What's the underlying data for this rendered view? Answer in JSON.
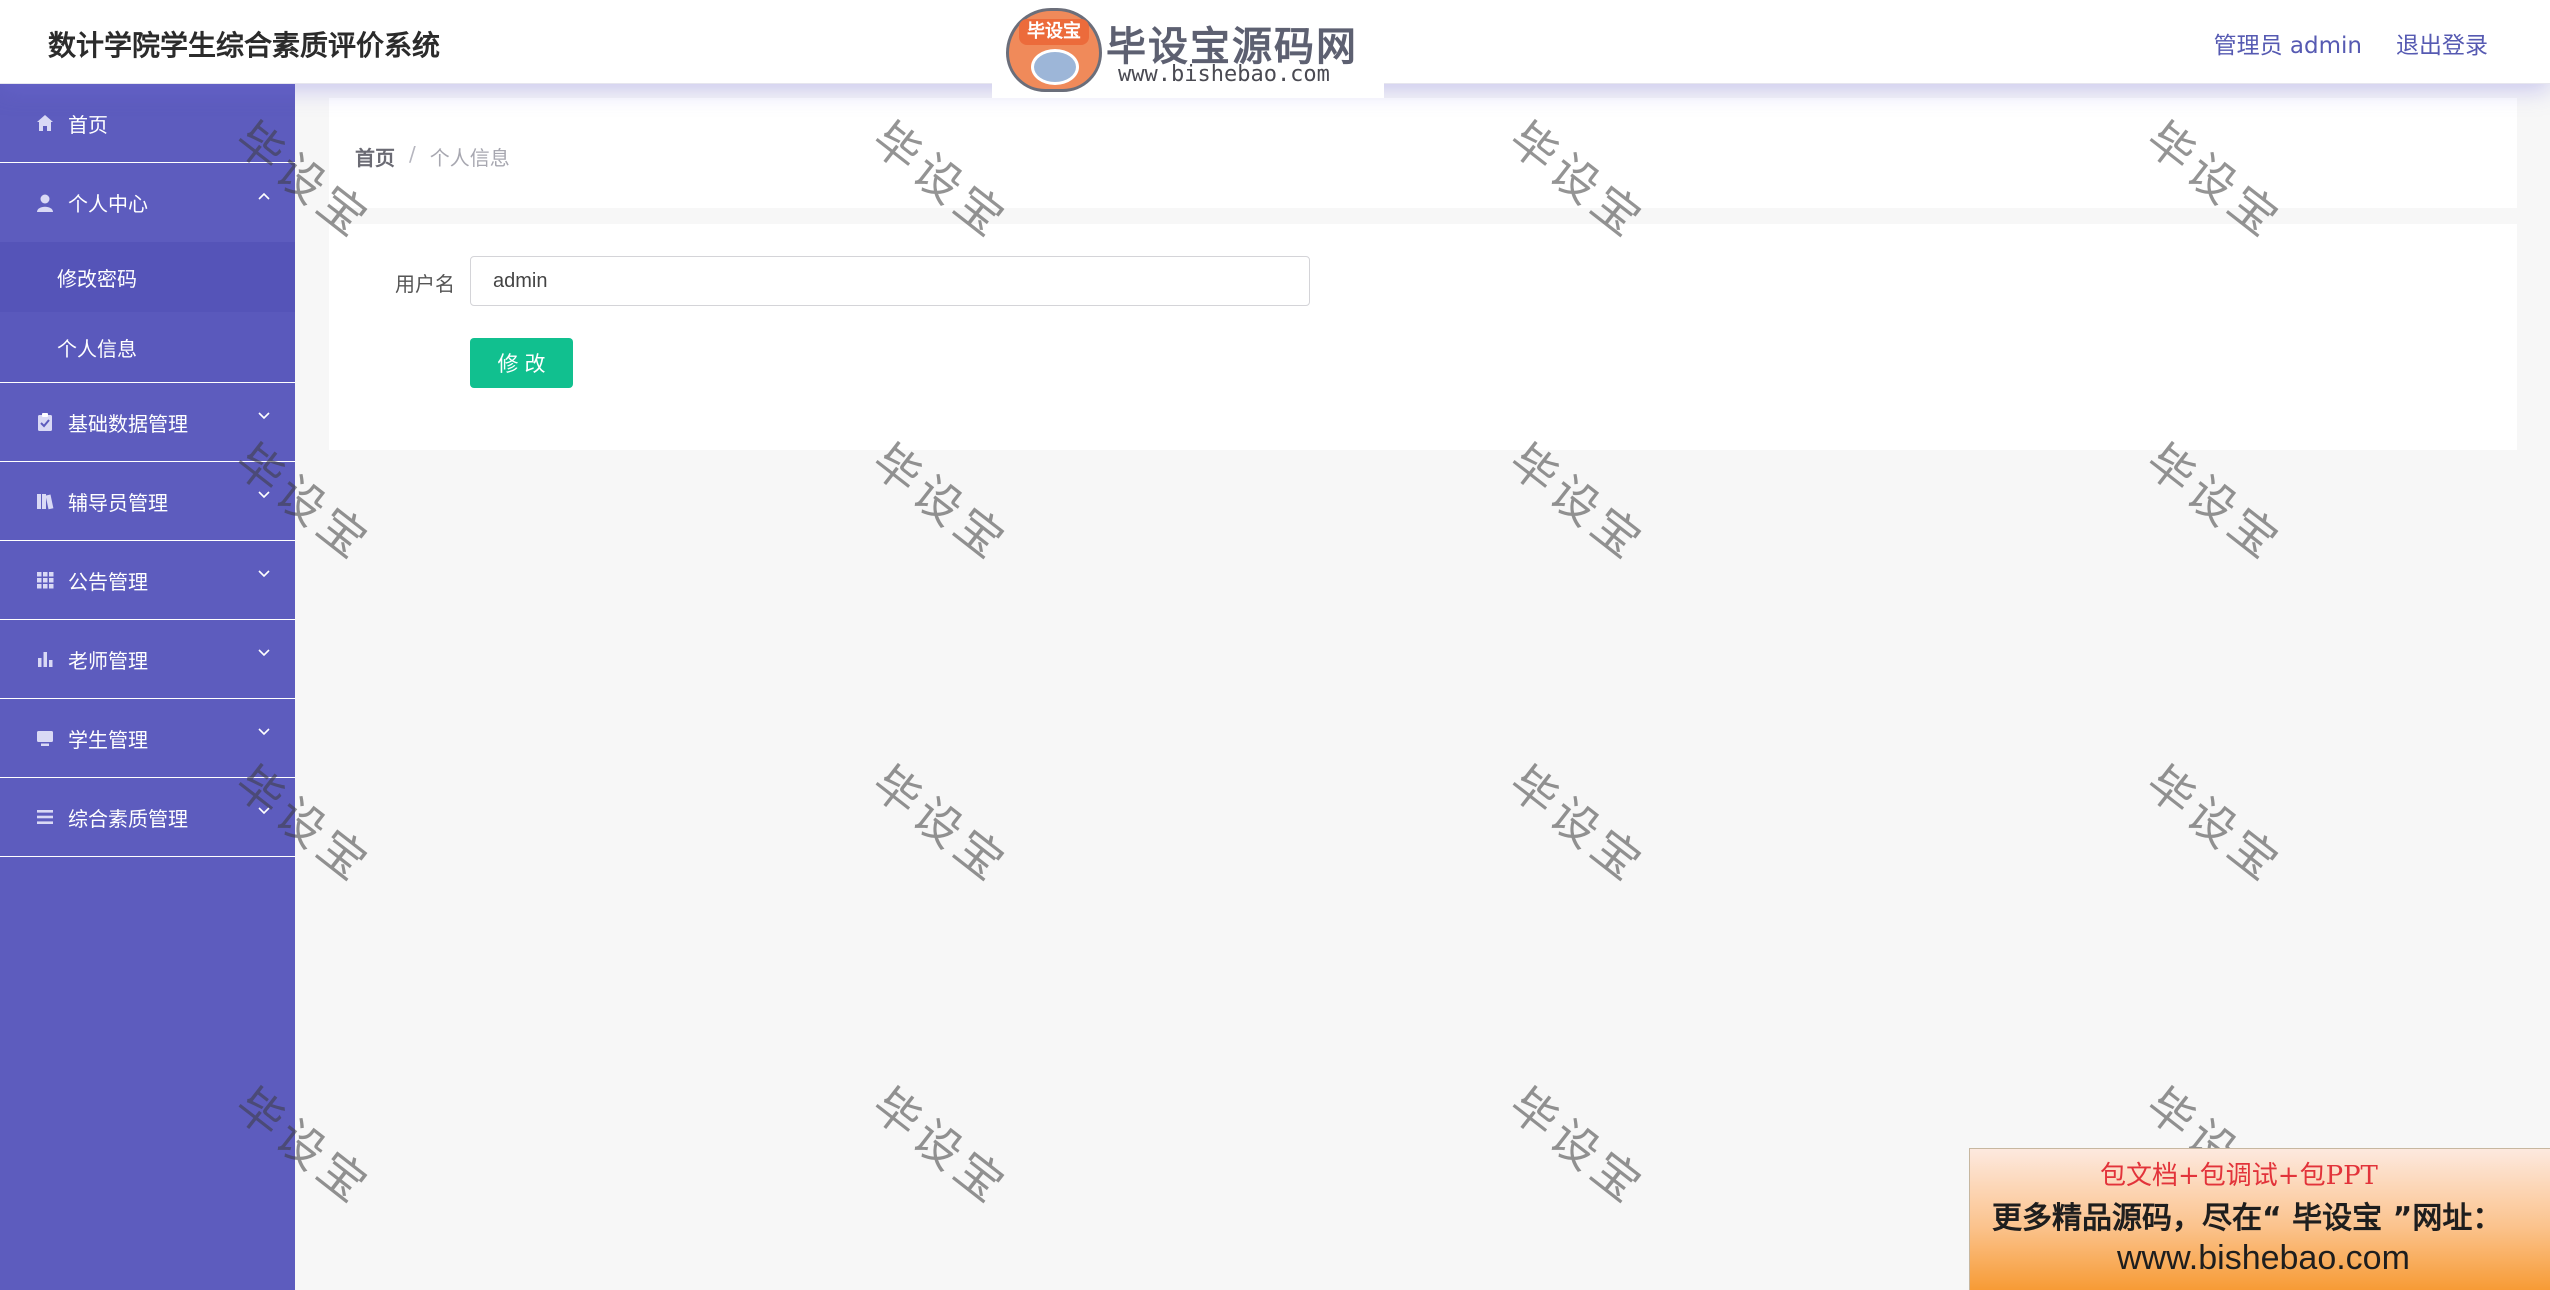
{
  "header": {
    "title": "数计学院学生综合素质评价系统",
    "user_label": "管理员 admin",
    "logout_label": "退出登录"
  },
  "brand": {
    "badge": "毕设宝",
    "name": "毕设宝源码网",
    "url": "www.bishebao.com"
  },
  "sidebar": {
    "items": [
      {
        "label": "首页",
        "icon": "home-icon"
      },
      {
        "label": "个人中心",
        "icon": "user-icon",
        "expanded": true,
        "children": [
          {
            "label": "修改密码"
          },
          {
            "label": "个人信息"
          }
        ]
      },
      {
        "label": "基础数据管理",
        "icon": "clipboard-icon"
      },
      {
        "label": "辅导员管理",
        "icon": "books-icon"
      },
      {
        "label": "公告管理",
        "icon": "grid-icon"
      },
      {
        "label": "老师管理",
        "icon": "bar-chart-icon"
      },
      {
        "label": "学生管理",
        "icon": "monitor-icon"
      },
      {
        "label": "综合素质管理",
        "icon": "list-icon"
      }
    ]
  },
  "breadcrumb": {
    "home": "首页",
    "separator": "/",
    "current": "个人信息"
  },
  "form": {
    "username_label": "用户名",
    "username_value": "admin",
    "submit_label": "修改"
  },
  "watermark": "毕设宝",
  "promo": {
    "line1": "包文档+包调试+包PPT",
    "line2": "更多精品源码，尽在“ 毕设宝 ”网址：",
    "line3": "www.bishebao.com"
  },
  "colors": {
    "sidebar": "#5d5cbe",
    "accent": "#565ab2",
    "button": "#11c08f"
  }
}
